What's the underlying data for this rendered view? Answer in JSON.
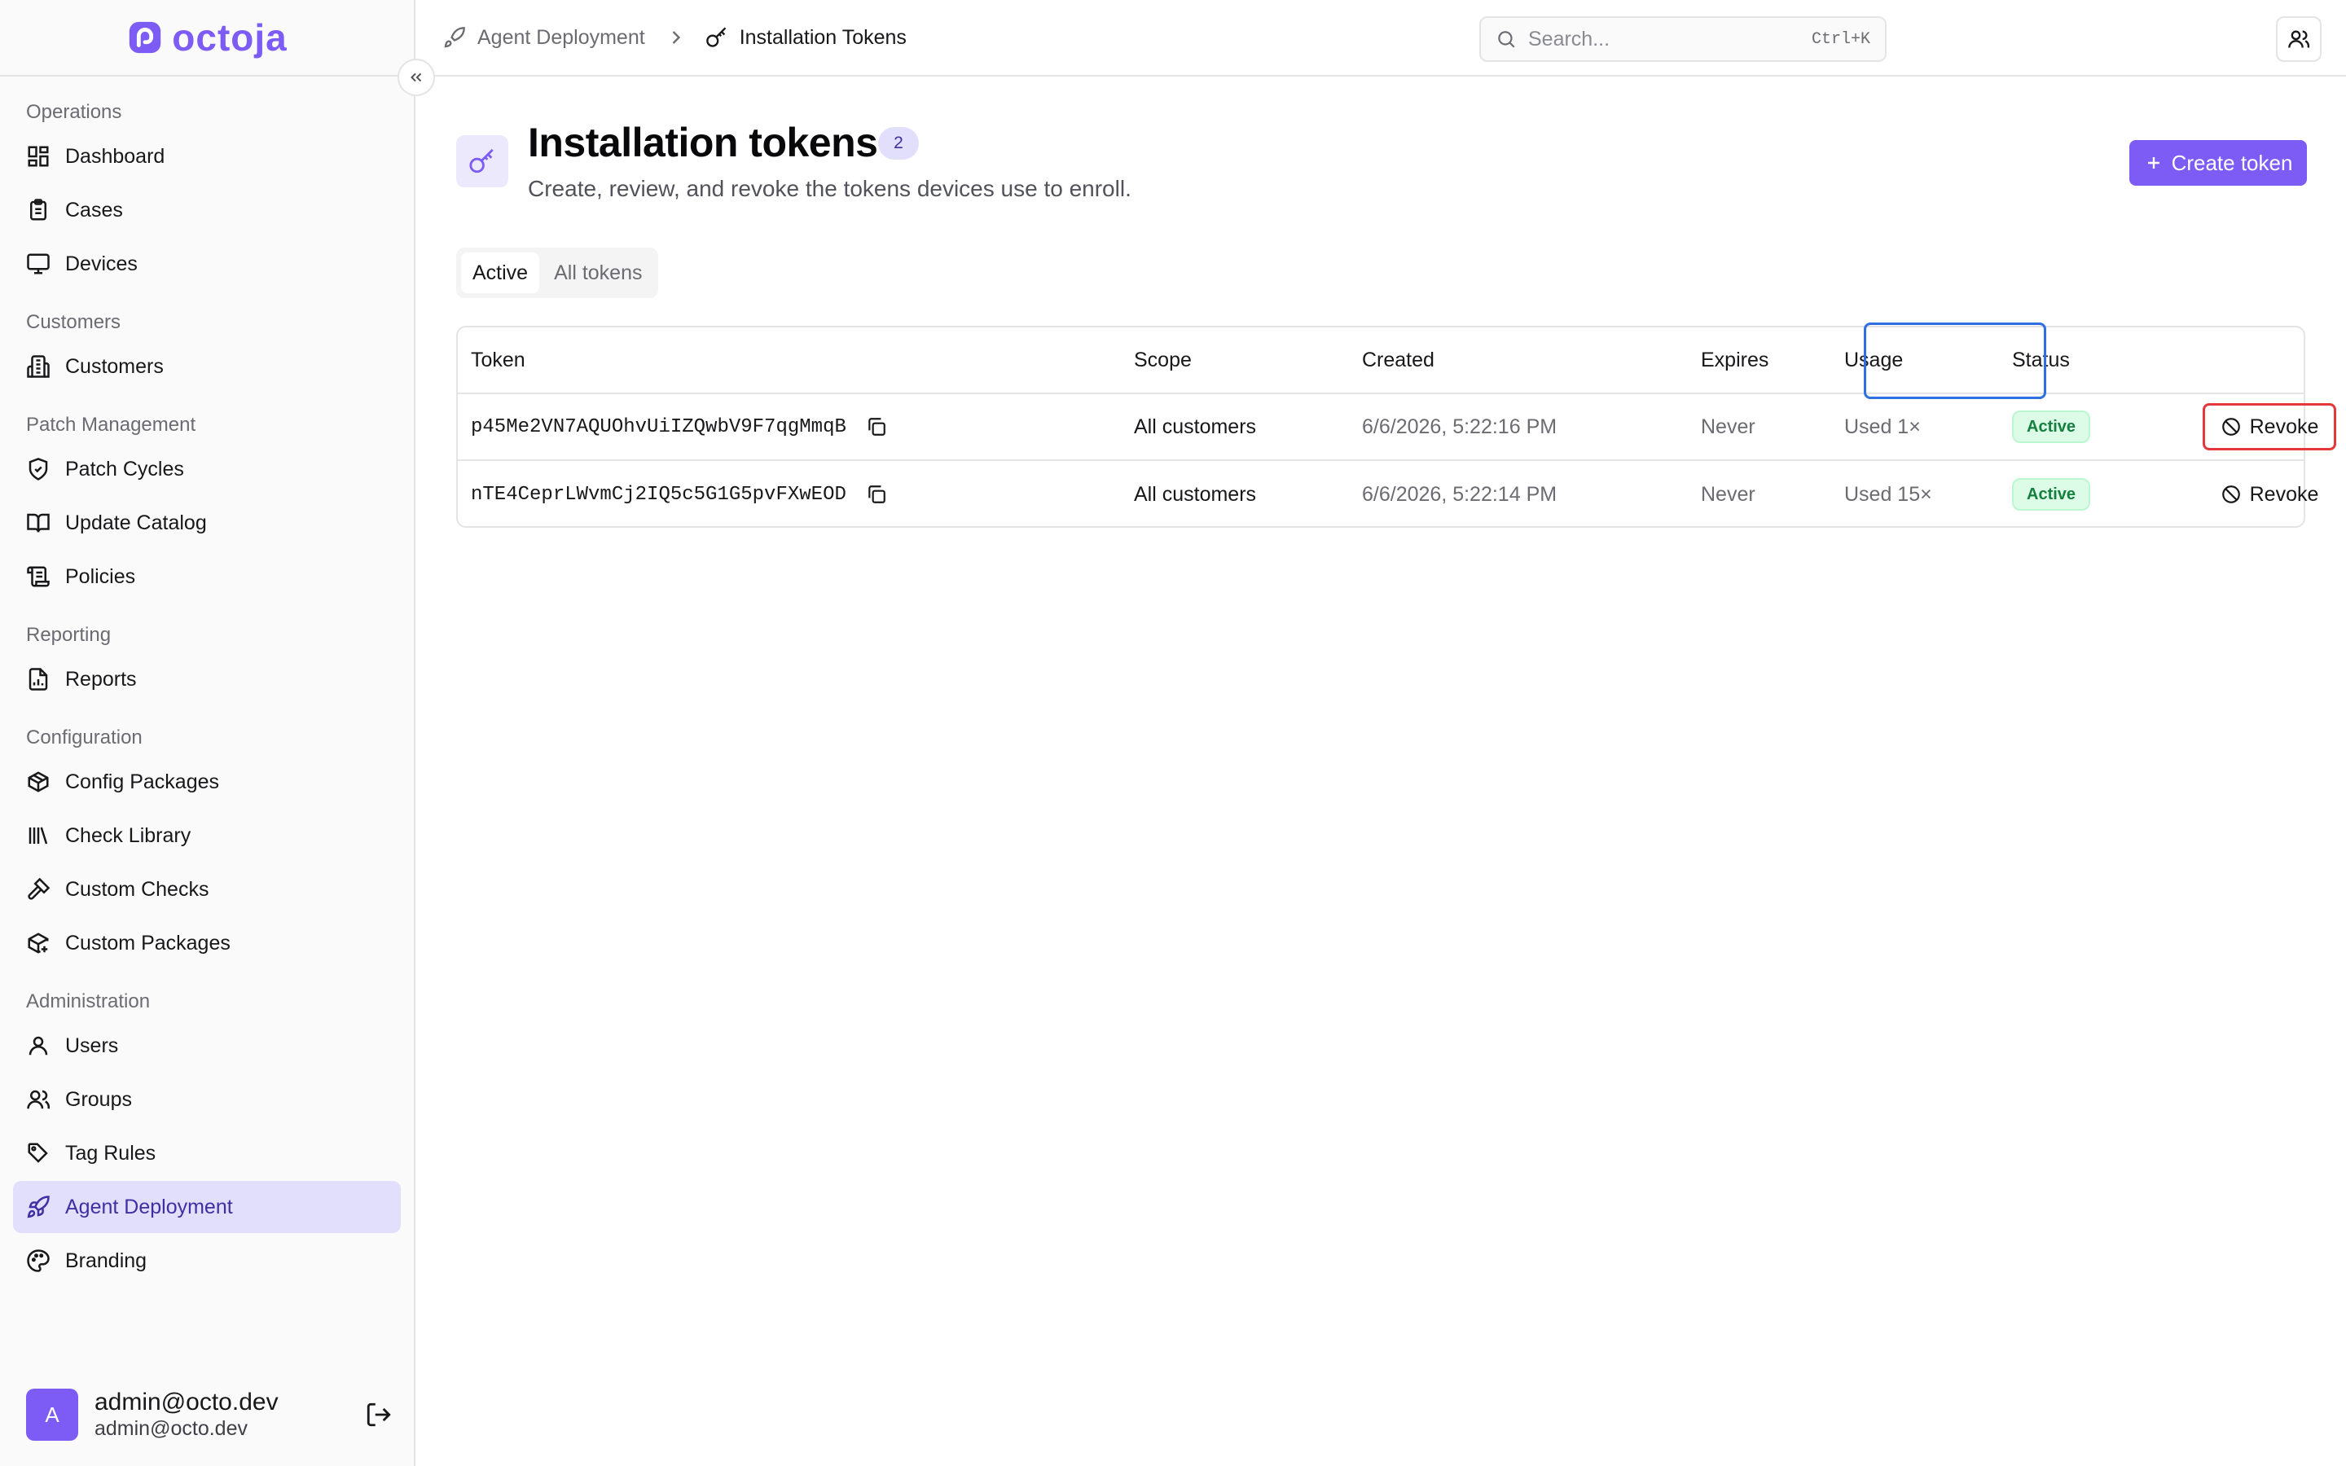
{
  "app": {
    "name": "octoja",
    "brand_color": "#7c5cf5"
  },
  "sidebar": {
    "sections": [
      {
        "label": "Operations",
        "items": [
          {
            "label": "Dashboard",
            "icon": "dashboard-icon"
          },
          {
            "label": "Cases",
            "icon": "clipboard-icon"
          },
          {
            "label": "Devices",
            "icon": "monitor-icon"
          }
        ]
      },
      {
        "label": "Customers",
        "items": [
          {
            "label": "Customers",
            "icon": "building-icon"
          }
        ]
      },
      {
        "label": "Patch Management",
        "items": [
          {
            "label": "Patch Cycles",
            "icon": "shield-check-icon"
          },
          {
            "label": "Update Catalog",
            "icon": "book-open-icon"
          },
          {
            "label": "Policies",
            "icon": "scroll-icon"
          }
        ]
      },
      {
        "label": "Reporting",
        "items": [
          {
            "label": "Reports",
            "icon": "file-chart-icon"
          }
        ]
      },
      {
        "label": "Configuration",
        "items": [
          {
            "label": "Config Packages",
            "icon": "package-icon"
          },
          {
            "label": "Check Library",
            "icon": "library-icon"
          },
          {
            "label": "Custom Checks",
            "icon": "hammer-icon"
          },
          {
            "label": "Custom Packages",
            "icon": "package-plus-icon"
          }
        ]
      },
      {
        "label": "Administration",
        "items": [
          {
            "label": "Users",
            "icon": "user-icon"
          },
          {
            "label": "Groups",
            "icon": "users-icon"
          },
          {
            "label": "Tag Rules",
            "icon": "tags-icon"
          },
          {
            "label": "Agent Deployment",
            "icon": "rocket-icon",
            "active": true
          },
          {
            "label": "Branding",
            "icon": "palette-icon"
          }
        ]
      }
    ],
    "user": {
      "avatar_letter": "A",
      "name": "admin@octo.dev",
      "email": "admin@octo.dev"
    }
  },
  "header": {
    "breadcrumb_parent": "Agent Deployment",
    "breadcrumb_current": "Installation Tokens",
    "search_placeholder": "Search...",
    "search_shortcut": "Ctrl+K"
  },
  "page": {
    "title": "Installation tokens",
    "count": "2",
    "subtitle": "Create, review, and revoke the tokens devices use to enroll.",
    "create_label": "Create token",
    "tabs": [
      {
        "label": "Active",
        "active": true
      },
      {
        "label": "All tokens",
        "active": false
      }
    ]
  },
  "table": {
    "columns": {
      "token": "Token",
      "scope": "Scope",
      "created": "Created",
      "expires": "Expires",
      "usage": "Usage",
      "status": "Status"
    },
    "rows": [
      {
        "token": "p45Me2VN7AQUOhvUiIZQwbV9F7qgMmqB",
        "scope": "All customers",
        "created": "6/6/2026, 5:22:16 PM",
        "expires": "Never",
        "usage": "Used 1×",
        "status": "Active",
        "action": "Revoke"
      },
      {
        "token": "nTE4CeprLWvmCj2IQ5c5G1G5pvFXwEOD",
        "scope": "All customers",
        "created": "6/6/2026, 5:22:14 PM",
        "expires": "Never",
        "usage": "Used 15×",
        "status": "Active",
        "action": "Revoke"
      }
    ]
  }
}
